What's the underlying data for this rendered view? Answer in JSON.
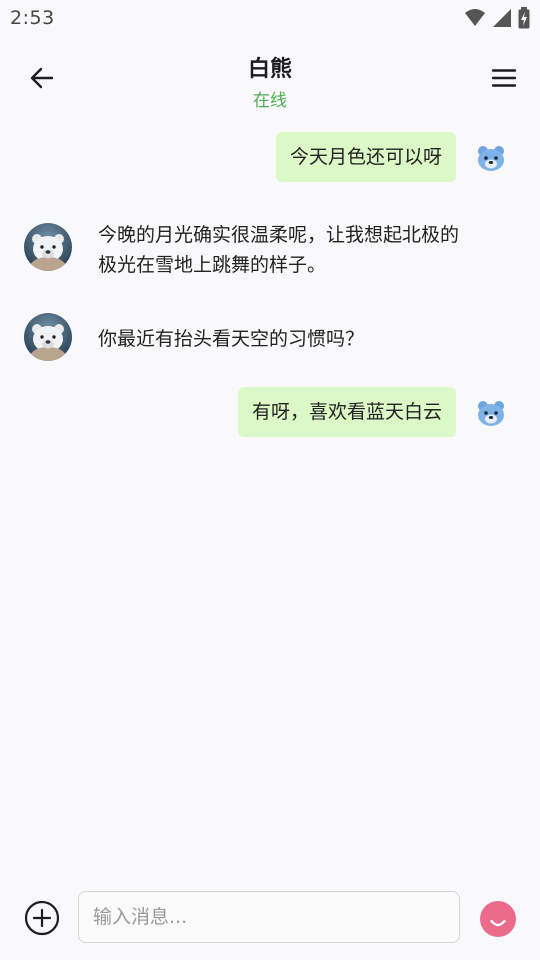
{
  "status_bar": {
    "time": "2:53"
  },
  "header": {
    "contact_name": "白熊",
    "contact_status": "在线"
  },
  "messages": [
    {
      "side": "out",
      "text": "今天月色还可以呀"
    },
    {
      "side": "in",
      "text": "今晚的月光确实很温柔呢，让我想起北极的极光在雪地上跳舞的样子。"
    },
    {
      "side": "in",
      "text": "你最近有抬头看天空的习惯吗？"
    },
    {
      "side": "out",
      "text": "有呀，喜欢看蓝天白云"
    }
  ],
  "composer": {
    "placeholder": "输入消息..."
  },
  "colors": {
    "outgoing_bubble": "#dcf8c6",
    "online_status": "#4caf50",
    "self_avatar": "#7fb2e6",
    "emoji_button": "#ec6b8a"
  },
  "icons": {
    "back": "arrow-left-icon",
    "menu": "hamburger-menu-icon",
    "add": "plus-circle-icon",
    "emoji": "emoji-icon",
    "self_avatar": "bear-face-icon"
  }
}
